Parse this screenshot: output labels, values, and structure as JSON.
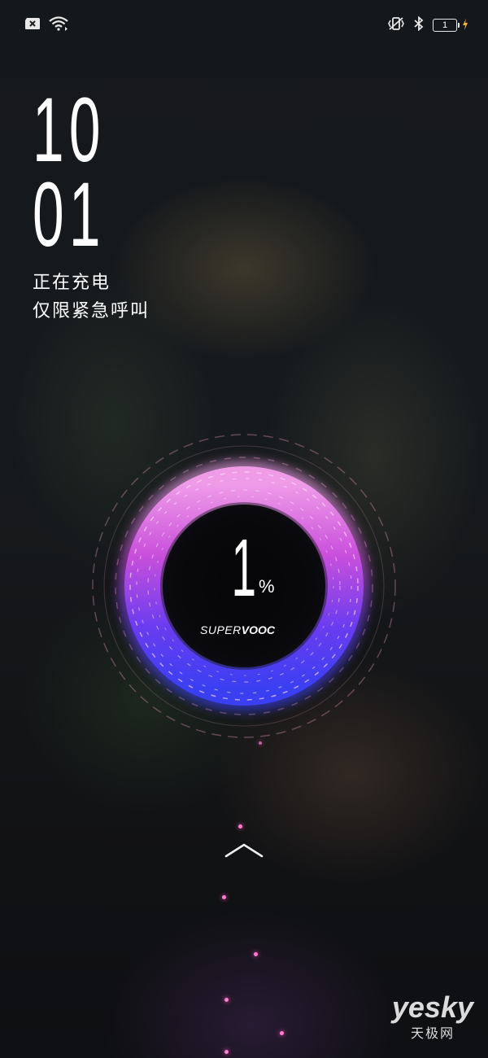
{
  "status_bar": {
    "battery_level": "1",
    "icons": [
      "sim-card-error-icon",
      "wifi-icon",
      "vibrate-icon",
      "bluetooth-icon",
      "battery-icon",
      "charging-bolt-icon"
    ]
  },
  "clock": {
    "hours": "10",
    "minutes": "01"
  },
  "status": {
    "charging": "正在充电",
    "emergency": "仅限紧急呼叫"
  },
  "charging_ring": {
    "percent": "1",
    "percent_sign": "%",
    "brand_light": "SUPER",
    "brand_bold": "VOOC",
    "gradient_top": "#e98ee3",
    "gradient_bottom": "#3f3cf0"
  },
  "unlock": {
    "icon": "chevron-up-icon"
  },
  "watermark": {
    "main": "yesky",
    "sub": "天极网"
  }
}
